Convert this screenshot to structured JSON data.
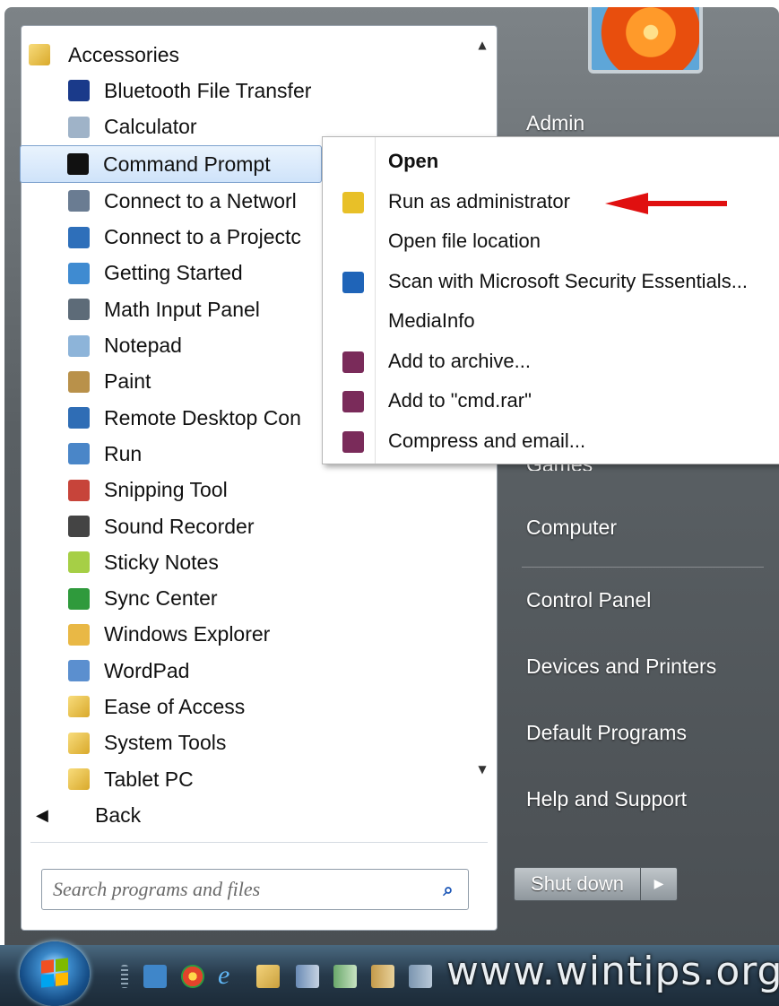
{
  "programs": {
    "items": [
      {
        "label": "Accessories",
        "icon": "folder-icon",
        "color": "#e2b53b",
        "level": "top"
      },
      {
        "label": "Bluetooth File Transfer",
        "icon": "bluetooth-icon",
        "color": "#1a3a8a",
        "level": "sub"
      },
      {
        "label": "Calculator",
        "icon": "calculator-icon",
        "color": "#9fb3c8",
        "level": "sub"
      },
      {
        "label": "Command Prompt",
        "icon": "command-prompt-icon",
        "color": "#111111",
        "level": "sub",
        "selected": true
      },
      {
        "label": "Connect to a Networl",
        "icon": "network-projector-icon",
        "color": "#6a7c92",
        "level": "sub"
      },
      {
        "label": "Connect to a Projectc",
        "icon": "projector-icon",
        "color": "#2e6fba",
        "level": "sub"
      },
      {
        "label": "Getting Started",
        "icon": "getting-started-icon",
        "color": "#3f8bd1",
        "level": "sub"
      },
      {
        "label": "Math Input Panel",
        "icon": "math-input-icon",
        "color": "#5d6b78",
        "level": "sub"
      },
      {
        "label": "Notepad",
        "icon": "notepad-icon",
        "color": "#8db4d9",
        "level": "sub"
      },
      {
        "label": "Paint",
        "icon": "paint-icon",
        "color": "#b9914a",
        "level": "sub"
      },
      {
        "label": "Remote Desktop Con",
        "icon": "remote-desktop-icon",
        "color": "#2f6db5",
        "level": "sub"
      },
      {
        "label": "Run",
        "icon": "run-icon",
        "color": "#4a86c8",
        "level": "sub"
      },
      {
        "label": "Snipping Tool",
        "icon": "scissors-icon",
        "color": "#c7443a",
        "level": "sub"
      },
      {
        "label": "Sound Recorder",
        "icon": "microphone-icon",
        "color": "#444444",
        "level": "sub"
      },
      {
        "label": "Sticky Notes",
        "icon": "sticky-notes-icon",
        "color": "#a6cf46",
        "level": "sub"
      },
      {
        "label": "Sync Center",
        "icon": "sync-icon",
        "color": "#2f9a3c",
        "level": "sub"
      },
      {
        "label": "Windows Explorer",
        "icon": "explorer-icon",
        "color": "#e9b845",
        "level": "sub"
      },
      {
        "label": "WordPad",
        "icon": "wordpad-icon",
        "color": "#5b8fcf",
        "level": "sub"
      },
      {
        "label": "Ease of Access",
        "icon": "folder-icon",
        "color": "#e2b53b",
        "level": "sub"
      },
      {
        "label": "System Tools",
        "icon": "folder-icon",
        "color": "#e2b53b",
        "level": "sub"
      },
      {
        "label": "Tablet PC",
        "icon": "folder-icon",
        "color": "#e2b53b",
        "level": "sub"
      }
    ],
    "back_label": "Back"
  },
  "search": {
    "placeholder": "Search programs and files"
  },
  "right_panel": {
    "user": "Admin",
    "games_partial": "Games",
    "computer": "Computer",
    "control_panel": "Control Panel",
    "devices_printers": "Devices and Printers",
    "default_programs": "Default Programs",
    "help_support": "Help and Support",
    "shutdown_label": "Shut down"
  },
  "context_menu": {
    "items": [
      {
        "label": "Open",
        "icon": "",
        "bold": true
      },
      {
        "label": "Run as administrator",
        "icon": "uac-shield-icon",
        "color": "#e8c028"
      },
      {
        "label": "Open file location",
        "icon": ""
      },
      {
        "label": "Scan with Microsoft Security Essentials...",
        "icon": "security-essentials-icon",
        "color": "#1f64b8"
      },
      {
        "label": "MediaInfo",
        "icon": ""
      },
      {
        "label": "Add to archive...",
        "icon": "winrar-icon",
        "color": "#7a2b5a"
      },
      {
        "label": "Add to \"cmd.rar\"",
        "icon": "winrar-icon",
        "color": "#7a2b5a"
      },
      {
        "label": "Compress and email...",
        "icon": "winrar-icon",
        "color": "#7a2b5a"
      }
    ]
  },
  "annotation": {
    "arrow_color": "#e01010"
  },
  "watermark": "www.wintips.org",
  "colors": {
    "accent": "#1d57b7",
    "selection": "#cfe3fa"
  }
}
